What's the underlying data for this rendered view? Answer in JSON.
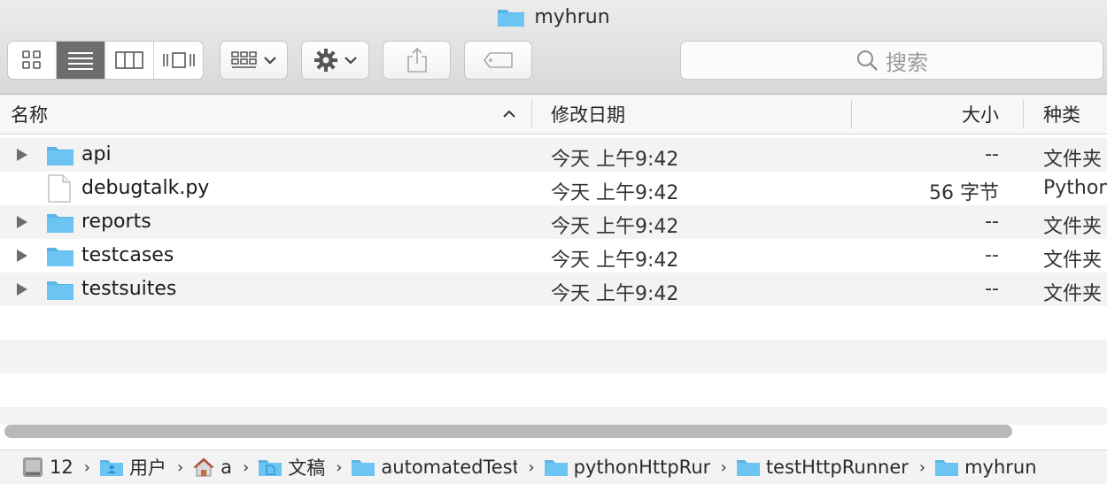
{
  "window": {
    "title": "myhrun"
  },
  "toolbar": {
    "view_modes": [
      "icon-view",
      "list-view",
      "column-view",
      "cover-flow-view"
    ],
    "active_view": "list-view",
    "search_placeholder": "搜索"
  },
  "columns": {
    "name": "名称",
    "date": "修改日期",
    "size": "大小",
    "kind": "种类"
  },
  "files": [
    {
      "name": "api",
      "date": "今天 上午9:42",
      "size": "--",
      "kind": "文件夹",
      "type": "folder"
    },
    {
      "name": "debugtalk.py",
      "date": "今天 上午9:42",
      "size": "56 字节",
      "kind": "Python",
      "type": "file"
    },
    {
      "name": "reports",
      "date": "今天 上午9:42",
      "size": "--",
      "kind": "文件夹",
      "type": "folder"
    },
    {
      "name": "testcases",
      "date": "今天 上午9:42",
      "size": "--",
      "kind": "文件夹",
      "type": "folder"
    },
    {
      "name": "testsuites",
      "date": "今天 上午9:42",
      "size": "--",
      "kind": "文件夹",
      "type": "folder"
    }
  ],
  "path": [
    {
      "label": "12",
      "icon": "disk-icon"
    },
    {
      "label": "用户",
      "icon": "users-folder-icon"
    },
    {
      "label": "a",
      "icon": "home-icon"
    },
    {
      "label": "文稿",
      "icon": "documents-folder-icon"
    },
    {
      "label": "automatedTest",
      "icon": "folder-icon"
    },
    {
      "label": "pythonHttpRun",
      "icon": "folder-icon"
    },
    {
      "label": "testHttpRunner",
      "icon": "folder-icon"
    },
    {
      "label": "myhrun",
      "icon": "folder-icon"
    }
  ],
  "colors": {
    "folder": "#6cc4f3",
    "folder_tab": "#5ab4e6",
    "active_segment": "#6d6d6d"
  }
}
